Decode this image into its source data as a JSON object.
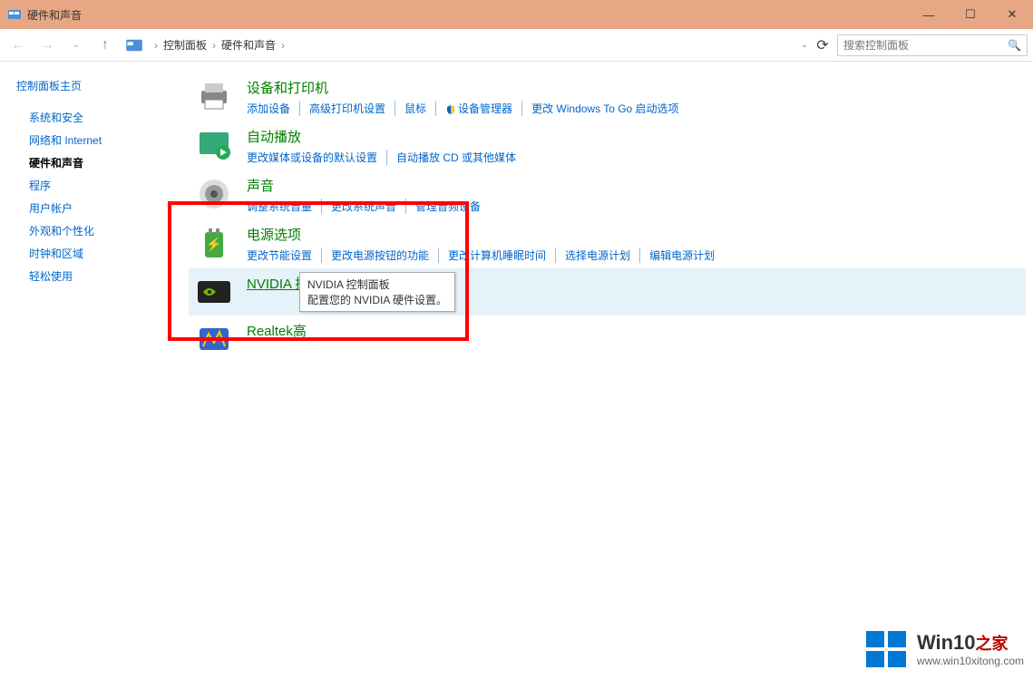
{
  "window": {
    "title": "硬件和声音"
  },
  "breadcrumb": {
    "item1": "控制面板",
    "item2": "硬件和声音"
  },
  "search": {
    "placeholder": "搜索控制面板"
  },
  "sidebar": {
    "title": "控制面板主页",
    "items": [
      {
        "label": "系统和安全",
        "active": false
      },
      {
        "label": "网络和 Internet",
        "active": false
      },
      {
        "label": "硬件和声音",
        "active": true
      },
      {
        "label": "程序",
        "active": false
      },
      {
        "label": "用户帐户",
        "active": false
      },
      {
        "label": "外观和个性化",
        "active": false
      },
      {
        "label": "时钟和区域",
        "active": false
      },
      {
        "label": "轻松使用",
        "active": false
      }
    ]
  },
  "categories": [
    {
      "icon": "printer-icon",
      "title": "设备和打印机",
      "links": [
        "添加设备",
        "高级打印机设置",
        "鼠标",
        "🛡设备管理器",
        "更改 Windows To Go 启动选项"
      ]
    },
    {
      "icon": "autoplay-icon",
      "title": "自动播放",
      "links": [
        "更改媒体或设备的默认设置",
        "自动播放 CD 或其他媒体"
      ]
    },
    {
      "icon": "sound-icon",
      "title": "声音",
      "links": [
        "调整系统音量",
        "更改系统声音",
        "管理音频设备"
      ]
    },
    {
      "icon": "power-icon",
      "title": "电源选项",
      "links": [
        "更改节能设置",
        "更改电源按钮的功能",
        "更改计算机睡眠时间",
        "选择电源计划",
        "编辑电源计划"
      ]
    },
    {
      "icon": "nvidia-icon",
      "title": "NVIDIA 控制面板",
      "highlighted": true,
      "links": []
    },
    {
      "icon": "realtek-icon",
      "title": "Realtek高",
      "links": []
    }
  ],
  "tooltip": {
    "line1": "NVIDIA 控制面板",
    "line2": "配置您的 NVIDIA 硬件设置。"
  },
  "watermark": {
    "title_main": "Win10",
    "title_accent": "之家",
    "url": "www.win10xitong.com"
  }
}
